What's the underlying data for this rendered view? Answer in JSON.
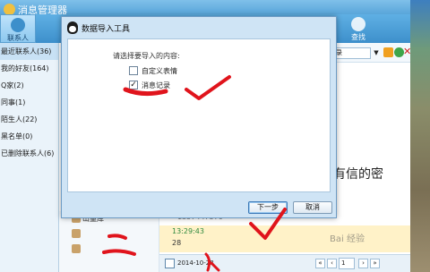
{
  "window": {
    "title": "消息管理器"
  },
  "toolbar": {
    "contacts_label": "联系人",
    "search_label": "查找"
  },
  "sidebar": {
    "items": [
      {
        "label": "最近联系人(36)"
      },
      {
        "label": "我的好友(164)"
      },
      {
        "label": "Q家(2)"
      },
      {
        "label": "同事(1)"
      },
      {
        "label": "陌生人(22)"
      },
      {
        "label": "黑名单(0)"
      },
      {
        "label": "已删除联系人(6)"
      }
    ]
  },
  "content": {
    "search_combo": "录",
    "big_text": "有信的密",
    "contact_row": "山量库",
    "phone": "1357447570",
    "msg_time": "13:29:43",
    "msg_body": "28",
    "date": "2014-10-28",
    "page_number": "1"
  },
  "dialog": {
    "title": "数据导入工具",
    "prompt": "请选择要导入的内容:",
    "options": [
      {
        "label": "自定义表情",
        "checked": false
      },
      {
        "label": "消息记录",
        "checked": true
      }
    ],
    "next_button": "下一步",
    "cancel_button": "取消"
  },
  "watermark": "Bai 经验",
  "colors": {
    "annotation_red": "#e0141c",
    "titlebar_blue": "#4a9bd3"
  }
}
